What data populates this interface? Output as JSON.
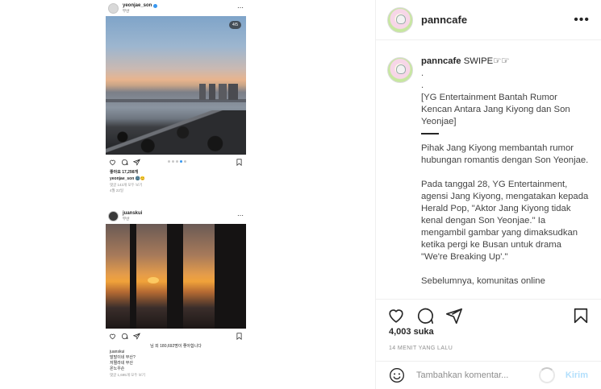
{
  "image": {
    "post1": {
      "username": "yeonjae_son",
      "location": "부산",
      "page_indicator": "4/5",
      "likes": "좋아요 17,298개",
      "caption_user": "yeonjae_son",
      "caption_emoji": "🌚😊",
      "comments_link": "댓글 143개 모두 보기",
      "date": "4월 22일"
    },
    "post2": {
      "username": "juanskui",
      "location": "부산",
      "likes": "님 외 180,692명이 좋아합니다",
      "caption_user": "juanskui",
      "caption_lines": [
        "말말이네 부산?",
        "저쩔라네 부산",
        "온노우손"
      ],
      "comments_link": "댓글 1,695개 모두 보기"
    }
  },
  "sidebar": {
    "username": "panncafe",
    "more_icon": "•••",
    "caption": {
      "username": "panncafe",
      "first_line": "SWIPE☞☞",
      "lines": [
        ".",
        ".",
        "[YG Entertainment Bantah Rumor Kencan Antara Jang Kiyong dan Son Yeonjae]"
      ],
      "para1": "Pihak Jang Kiyong membantah rumor hubungan romantis dengan Son Yeonjae.",
      "para2": "Pada tanggal 28, YG Entertainment, agensi Jang Kiyong, mengatakan kepada Herald Pop, \"Aktor Jang Kiyong tidak kenal dengan Son Yeonjae.\" Ia mengambil gambar yang dimaksudkan ketika pergi ke Busan untuk drama \"We're Breaking Up'.\"",
      "para3": "Sebelumnya, komunitas online"
    },
    "likes": "4,003 suka",
    "time": "14 menit yang lalu",
    "comment": {
      "placeholder": "Tambahkan komentar...",
      "post_label": "Kirim"
    }
  },
  "icons": {
    "like": "heart-icon",
    "comment": "comment-icon",
    "share": "share-icon",
    "save": "bookmark-icon",
    "emoji": "emoji-icon"
  }
}
